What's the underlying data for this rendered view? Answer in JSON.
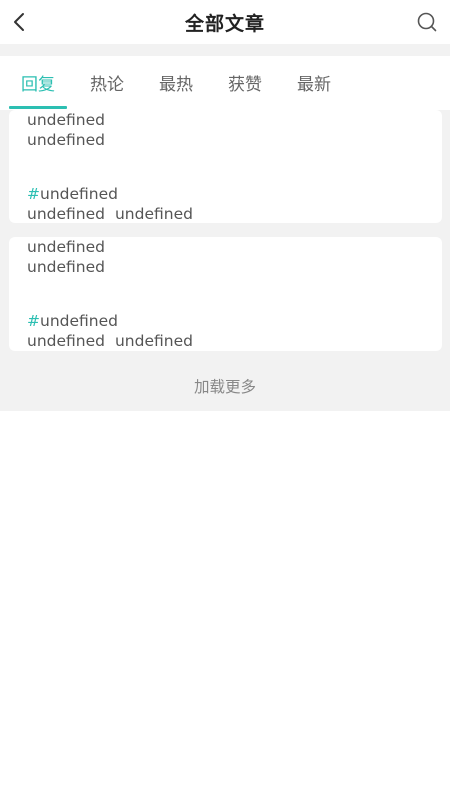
{
  "header": {
    "title": "全部文章"
  },
  "tabs": [
    {
      "label": "回复",
      "active": true
    },
    {
      "label": "热论",
      "active": false
    },
    {
      "label": "最热",
      "active": false
    },
    {
      "label": "获赞",
      "active": false
    },
    {
      "label": "最新",
      "active": false
    }
  ],
  "articles": [
    {
      "title": "undefined",
      "summary": "undefined",
      "hash_symbol": "#",
      "topic": "undefined",
      "meta_left": "undefined",
      "meta_right": "undefined"
    },
    {
      "title": "undefined",
      "summary": "undefined",
      "hash_symbol": "#",
      "topic": "undefined",
      "meta_left": "undefined",
      "meta_right": "undefined"
    }
  ],
  "load_more_label": "加载更多",
  "colors": {
    "accent": "#2cbfb2",
    "background_gray": "#f2f2f2"
  },
  "icons": {
    "back": "chevron-left-icon",
    "search": "search-icon"
  }
}
